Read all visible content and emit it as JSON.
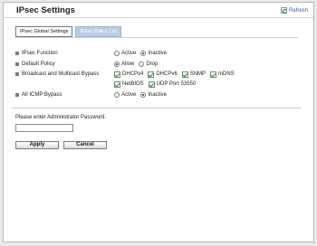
{
  "header": {
    "title": "IPsec Settings",
    "refresh_label": "Refresh"
  },
  "tabs": [
    {
      "label": "IPsec Global Settings",
      "active": true
    },
    {
      "label": "IPsec Policy List",
      "active": false
    }
  ],
  "settings": {
    "ipsec_function": {
      "label": "IPsec Function",
      "options": [
        {
          "label": "Active",
          "selected": false
        },
        {
          "label": "Inactive",
          "selected": true
        }
      ]
    },
    "default_policy": {
      "label": "Default Policy",
      "options": [
        {
          "label": "Allow",
          "selected": true
        },
        {
          "label": "Drop",
          "selected": false
        }
      ]
    },
    "broadcast_multicast_bypass": {
      "label": "Broadcast and Multicast Bypass",
      "options": [
        {
          "label": "DHCPv4",
          "checked": true
        },
        {
          "label": "DHCPv6",
          "checked": true
        },
        {
          "label": "SNMP",
          "checked": true
        },
        {
          "label": "mDNS",
          "checked": true
        },
        {
          "label": "NetBIOS",
          "checked": true
        },
        {
          "label": "UDP Port 53550",
          "checked": true
        }
      ]
    },
    "all_icmp_bypass": {
      "label": "All ICMP Bypass",
      "options": [
        {
          "label": "Active",
          "selected": false
        },
        {
          "label": "Inactive",
          "selected": true
        }
      ]
    }
  },
  "password": {
    "prompt": "Please enter Administrator Password.",
    "value": ""
  },
  "buttons": {
    "apply": "Apply",
    "cancel": "Cancel"
  },
  "colors": {
    "inactive_tab": "#b9cde2",
    "link": "#3a5fa0",
    "check": "#2e7d2e"
  }
}
